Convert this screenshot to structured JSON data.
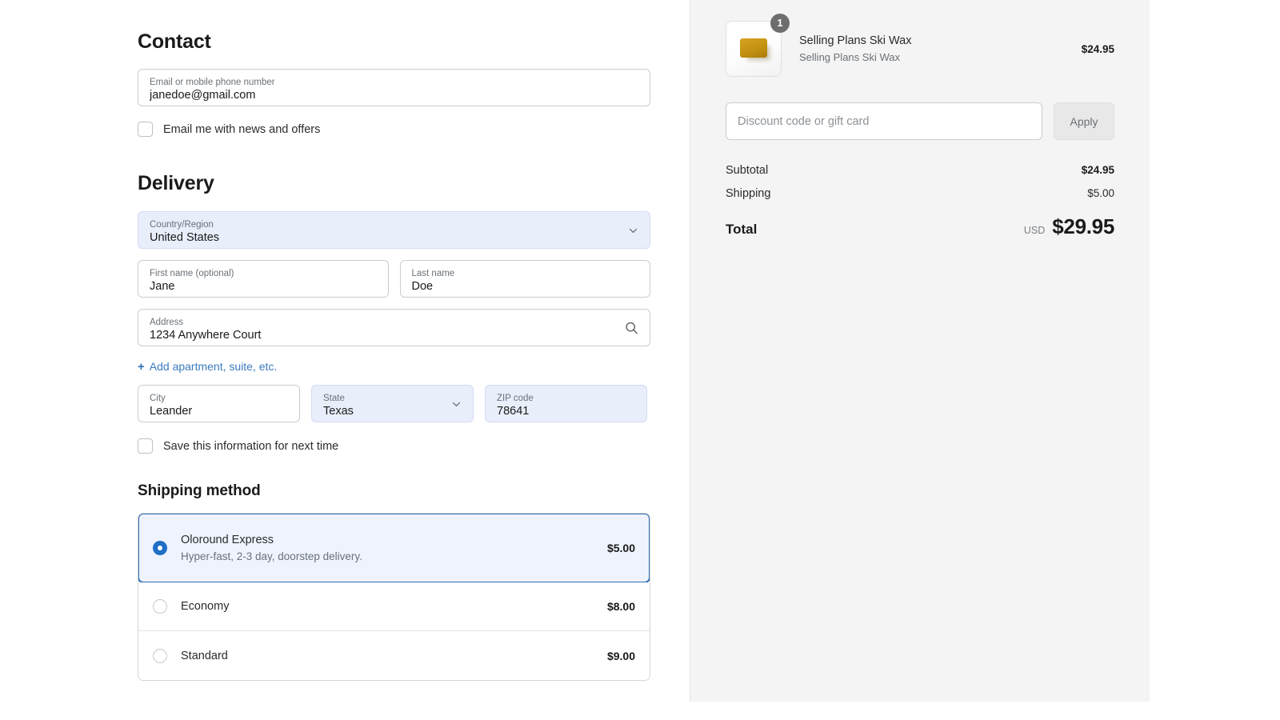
{
  "contact": {
    "title": "Contact",
    "email_label": "Email or mobile phone number",
    "email_value": "janedoe@gmail.com",
    "optin_label": "Email me with news and offers"
  },
  "delivery": {
    "title": "Delivery",
    "country_label": "Country/Region",
    "country_value": "United States",
    "first_name_label": "First name (optional)",
    "first_name_value": "Jane",
    "last_name_label": "Last name",
    "last_name_value": "Doe",
    "address_label": "Address",
    "address_value": "1234 Anywhere Court",
    "add_apartment_plus": "+",
    "add_apartment_label": "Add apartment, suite, etc.",
    "city_label": "City",
    "city_value": "Leander",
    "state_label": "State",
    "state_value": "Texas",
    "zip_label": "ZIP code",
    "zip_value": "78641",
    "save_label": "Save this information for next time"
  },
  "shipping": {
    "title": "Shipping method",
    "options": [
      {
        "name": "Oloround Express",
        "description": "Hyper-fast, 2-3 day, doorstep delivery.",
        "price": "$5.00",
        "selected": true
      },
      {
        "name": "Economy",
        "description": "",
        "price": "$8.00",
        "selected": false
      },
      {
        "name": "Standard",
        "description": "",
        "price": "$9.00",
        "selected": false
      }
    ]
  },
  "order_summary": {
    "item": {
      "title": "Selling Plans Ski Wax",
      "variant": "Selling Plans Ski Wax",
      "price": "$24.95",
      "quantity": "1"
    },
    "discount_placeholder": "Discount code or gift card",
    "apply_label": "Apply",
    "subtotal_label": "Subtotal",
    "subtotal_value": "$24.95",
    "shipping_label": "Shipping",
    "shipping_value": "$5.00",
    "total_label": "Total",
    "total_currency": "USD",
    "total_value": "$29.95"
  },
  "colors": {
    "accent_blue": "#1f6fc4",
    "link_blue": "#3b7bbf",
    "field_filled": "#e9eefb",
    "panel_bg": "#f4f4f4",
    "product_gold": "#c18f10"
  }
}
